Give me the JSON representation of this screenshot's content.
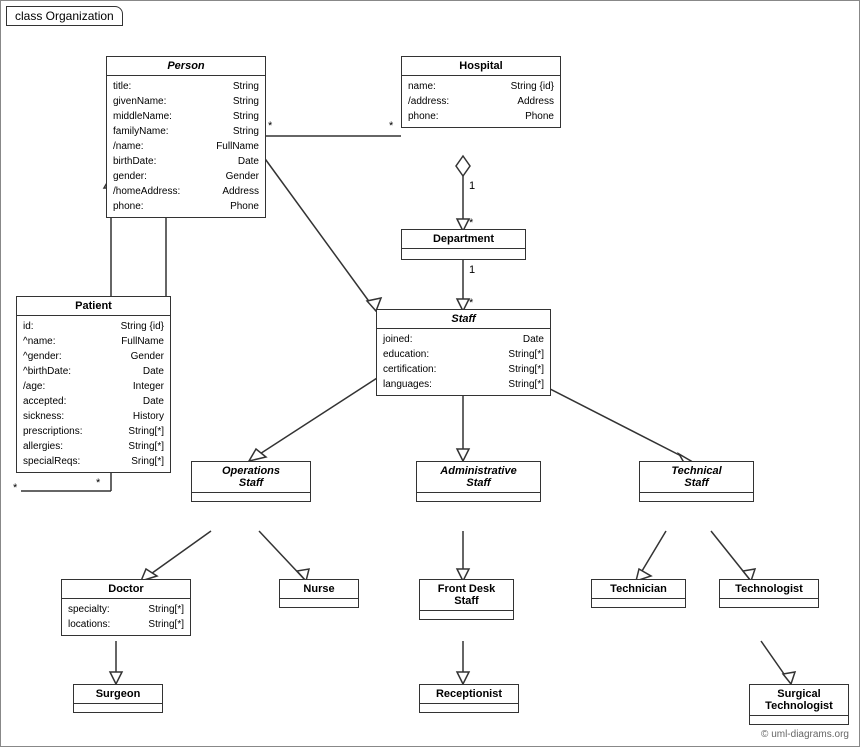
{
  "title": "class Organization",
  "copyright": "© uml-diagrams.org",
  "classes": {
    "person": {
      "name": "Person",
      "italic": true,
      "attrs": [
        [
          "title:",
          "String"
        ],
        [
          "givenName:",
          "String"
        ],
        [
          "middleName:",
          "String"
        ],
        [
          "familyName:",
          "String"
        ],
        [
          "/name:",
          "FullName"
        ],
        [
          "birthDate:",
          "Date"
        ],
        [
          "gender:",
          "Gender"
        ],
        [
          "/homeAddress:",
          "Address"
        ],
        [
          "phone:",
          "Phone"
        ]
      ]
    },
    "hospital": {
      "name": "Hospital",
      "italic": false,
      "attrs": [
        [
          "name:",
          "String {id}"
        ],
        [
          "/address:",
          "Address"
        ],
        [
          "phone:",
          "Phone"
        ]
      ]
    },
    "patient": {
      "name": "Patient",
      "italic": false,
      "attrs": [
        [
          "id:",
          "String {id}"
        ],
        [
          "^name:",
          "FullName"
        ],
        [
          "^gender:",
          "Gender"
        ],
        [
          "^birthDate:",
          "Date"
        ],
        [
          "/age:",
          "Integer"
        ],
        [
          "accepted:",
          "Date"
        ],
        [
          "sickness:",
          "History"
        ],
        [
          "prescriptions:",
          "String[*]"
        ],
        [
          "allergies:",
          "String[*]"
        ],
        [
          "specialReqs:",
          "Sring[*]"
        ]
      ]
    },
    "department": {
      "name": "Department",
      "italic": false,
      "attrs": []
    },
    "staff": {
      "name": "Staff",
      "italic": true,
      "attrs": [
        [
          "joined:",
          "Date"
        ],
        [
          "education:",
          "String[*]"
        ],
        [
          "certification:",
          "String[*]"
        ],
        [
          "languages:",
          "String[*]"
        ]
      ]
    },
    "operationsStaff": {
      "name": "Operations\nStaff",
      "italic": true,
      "attrs": []
    },
    "administrativeStaff": {
      "name": "Administrative\nStaff",
      "italic": true,
      "attrs": []
    },
    "technicalStaff": {
      "name": "Technical\nStaff",
      "italic": true,
      "attrs": []
    },
    "doctor": {
      "name": "Doctor",
      "italic": false,
      "attrs": [
        [
          "specialty:",
          "String[*]"
        ],
        [
          "locations:",
          "String[*]"
        ]
      ]
    },
    "nurse": {
      "name": "Nurse",
      "italic": false,
      "attrs": []
    },
    "frontDeskStaff": {
      "name": "Front Desk\nStaff",
      "italic": false,
      "attrs": []
    },
    "technician": {
      "name": "Technician",
      "italic": false,
      "attrs": []
    },
    "technologist": {
      "name": "Technologist",
      "italic": false,
      "attrs": []
    },
    "surgeon": {
      "name": "Surgeon",
      "italic": false,
      "attrs": []
    },
    "receptionist": {
      "name": "Receptionist",
      "italic": false,
      "attrs": []
    },
    "surgicalTechnologist": {
      "name": "Surgical\nTechnologist",
      "italic": false,
      "attrs": []
    }
  }
}
